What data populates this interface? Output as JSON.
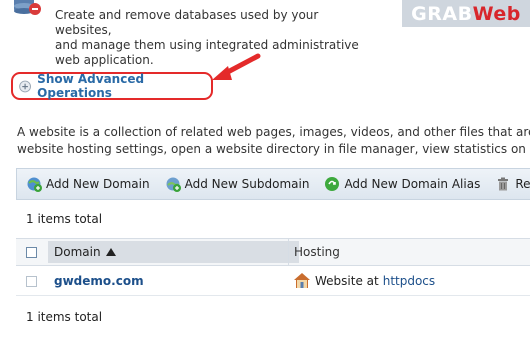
{
  "databases": {
    "description_line1": "Create and remove databases used by your websites,",
    "description_line2": "and manage them using integrated administrative",
    "description_line3": "web application."
  },
  "watermark": {
    "part1": "GRAB",
    "part2": "Web"
  },
  "advanced": {
    "label": "Show Advanced Operations"
  },
  "websites": {
    "description_line1": "A website is a collection of related web pages, images, videos, and other files that are",
    "description_line2": "website hosting settings, open a website directory in file manager, view statistics on we"
  },
  "toolbar": {
    "add_domain": "Add New Domain",
    "add_subdomain": "Add New Subdomain",
    "add_alias": "Add New Domain Alias",
    "remove": "Remo"
  },
  "list": {
    "total_top": "1 items total",
    "total_bottom": "1 items total",
    "columns": {
      "domain": "Domain",
      "hosting": "Hosting"
    },
    "rows": [
      {
        "domain": "gwdemo.com",
        "hosting_prefix": "Website at",
        "hosting_link": "httpdocs"
      }
    ]
  },
  "colors": {
    "link": "#1c4f8a",
    "highlight": "#e42a2a",
    "watermark_bg": "#cfd6de"
  }
}
